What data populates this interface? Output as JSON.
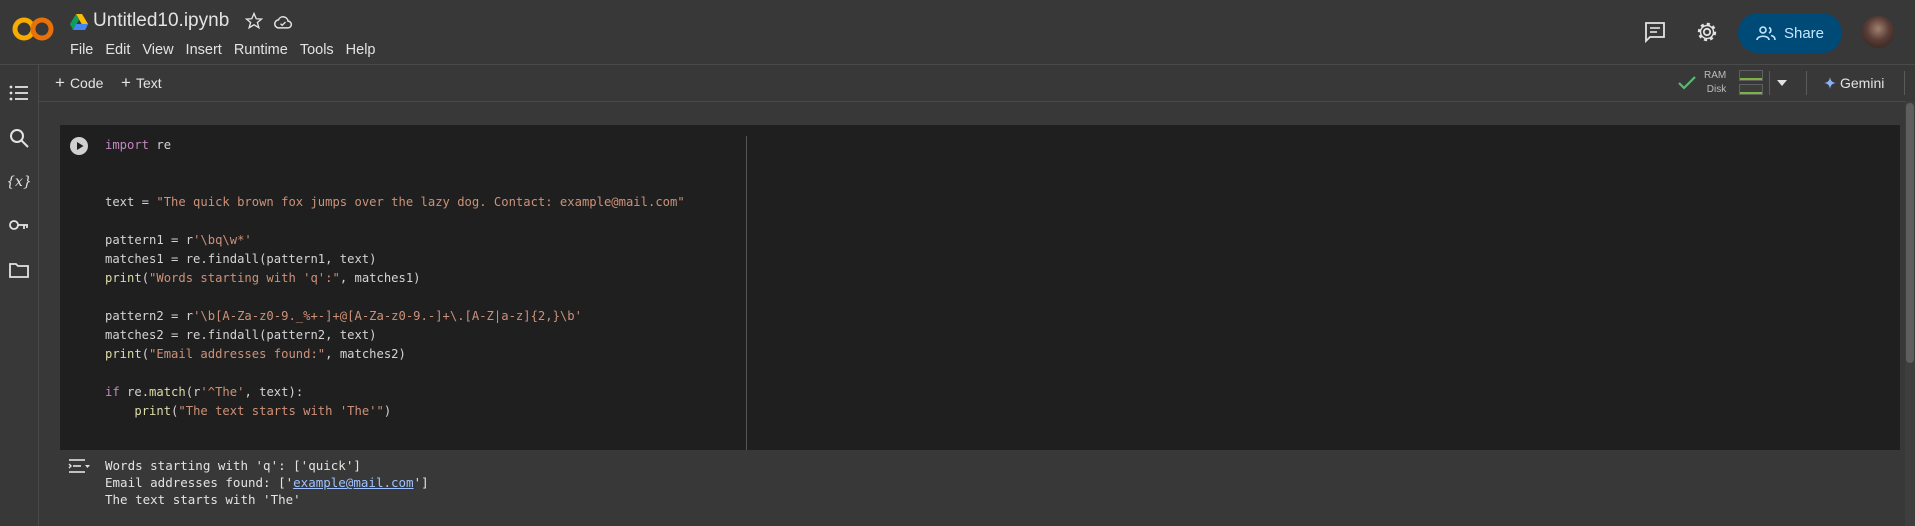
{
  "app": {
    "notebook_title": "Untitled10.ipynb"
  },
  "menu": [
    "File",
    "Edit",
    "View",
    "Insert",
    "Runtime",
    "Tools",
    "Help"
  ],
  "header": {
    "share_label": "Share"
  },
  "toolbar": {
    "code_label": "Code",
    "text_label": "Text",
    "ram_label": "RAM",
    "disk_label": "Disk",
    "gemini_label": "Gemini"
  },
  "cell": {
    "code_lines": [
      [
        {
          "t": "import",
          "c": "kw"
        },
        {
          "t": " re"
        }
      ],
      [],
      [],
      [
        {
          "t": "text = "
        },
        {
          "t": "\"The quick brown fox jumps over the lazy dog. Contact: example@mail.com\"",
          "c": "str"
        }
      ],
      [],
      [
        {
          "t": "pattern1 = r"
        },
        {
          "t": "'\\bq\\w*'",
          "c": "str"
        }
      ],
      [
        {
          "t": "matches1 = re.findall(pattern1, text)"
        }
      ],
      [
        {
          "t": "print",
          "c": "fn"
        },
        {
          "t": "("
        },
        {
          "t": "\"Words starting with 'q':\"",
          "c": "str"
        },
        {
          "t": ", matches1)"
        }
      ],
      [],
      [
        {
          "t": "pattern2 = r"
        },
        {
          "t": "'\\b[A-Za-z0-9._%+-]+@[A-Za-z0-9.-]+\\.[A-Z|a-z]{2,}\\b'",
          "c": "str"
        }
      ],
      [
        {
          "t": "matches2 = re.findall(pattern2, text)"
        }
      ],
      [
        {
          "t": "print",
          "c": "fn"
        },
        {
          "t": "("
        },
        {
          "t": "\"Email addresses found:\"",
          "c": "str"
        },
        {
          "t": ", matches2)"
        }
      ],
      [],
      [
        {
          "t": "if",
          "c": "kw"
        },
        {
          "t": " re."
        },
        {
          "t": "match",
          "c": "fn"
        },
        {
          "t": "(r"
        },
        {
          "t": "'^The'",
          "c": "str"
        },
        {
          "t": ", text):"
        }
      ],
      [
        {
          "t": "    "
        },
        {
          "t": "print",
          "c": "fn"
        },
        {
          "t": "("
        },
        {
          "t": "\"The text starts with 'The'\"",
          "c": "str"
        },
        {
          "t": ")"
        }
      ]
    ]
  },
  "output": {
    "line1": "Words starting with 'q': ['quick']",
    "line2_prefix": "Email addresses found: ['",
    "line2_link": "example@mail.com",
    "line2_suffix": "']",
    "line3": "The text starts with 'The'"
  },
  "colors": {
    "accent_share": "#004a77",
    "keyword": "#c586c0",
    "string": "#ce9178",
    "function": "#dcdcaa"
  }
}
